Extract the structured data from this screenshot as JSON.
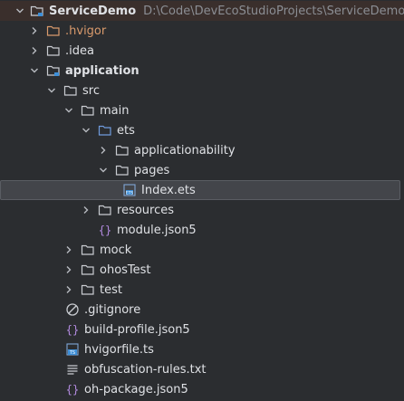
{
  "project": {
    "name": "ServiceDemo",
    "path": "D:\\Code\\DevEcoStudioProjects\\ServiceDemo"
  },
  "tree": {
    "hvigor": ".hvigor",
    "idea": ".idea",
    "application": "application",
    "src": "src",
    "main": "main",
    "ets": "ets",
    "applicationability": "applicationability",
    "pages": "pages",
    "index_ets": "Index.ets",
    "resources": "resources",
    "module_json5": "module.json5",
    "mock": "mock",
    "ohostest": "ohosTest",
    "test": "test",
    "gitignore": ".gitignore",
    "build_profile": "build-profile.json5",
    "hvigorfile": "hvigorfile.ts",
    "obfuscation": "obfuscation-rules.txt",
    "oh_package": "oh-package.json5"
  },
  "colors": {
    "background": "#2b2d30",
    "selected_row": "#43454a",
    "root_row": "#3a2f2c",
    "folder_gray": "#c9ccd1",
    "folder_orange": "#d99a6c",
    "folder_blue": "#6f9bdc",
    "json_purple": "#b38be0",
    "ts_blue": "#3d8fd8"
  },
  "icons": [
    "chevron-down-icon",
    "chevron-right-icon",
    "folder-icon",
    "module-folder-icon",
    "source-folder-icon",
    "excluded-folder-icon",
    "json-file-icon",
    "ets-file-icon",
    "ts-file-icon",
    "text-file-icon",
    "ignore-file-icon"
  ]
}
